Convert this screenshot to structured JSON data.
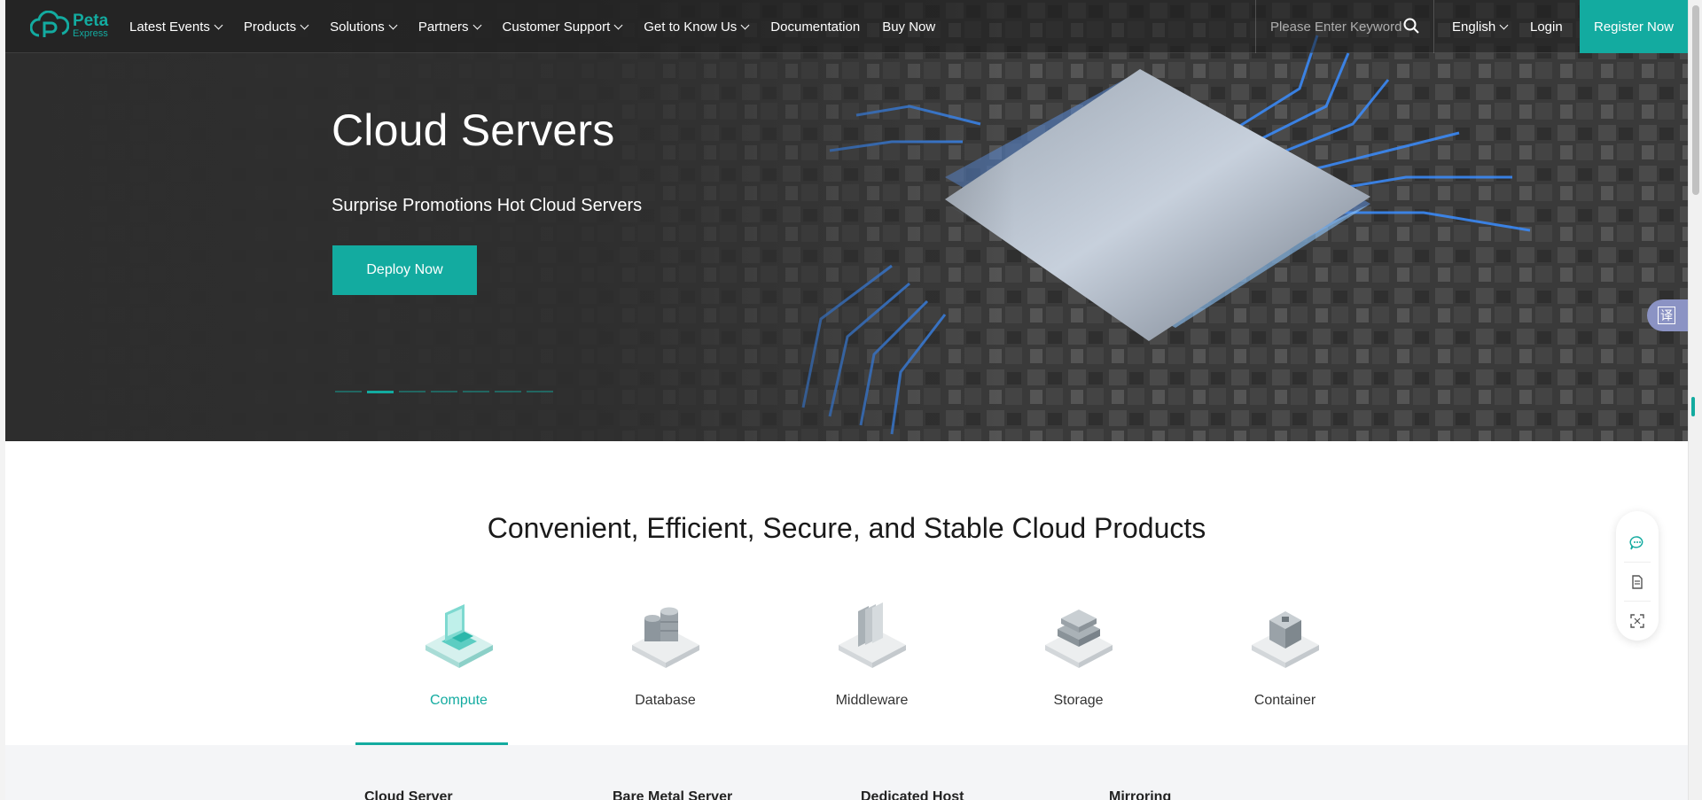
{
  "header": {
    "logo": {
      "name": "Peta",
      "sub": "Express"
    },
    "nav": [
      {
        "label": "Latest Events",
        "dropdown": true
      },
      {
        "label": "Products",
        "dropdown": true
      },
      {
        "label": "Solutions",
        "dropdown": true
      },
      {
        "label": "Partners",
        "dropdown": true
      },
      {
        "label": "Customer Support",
        "dropdown": true
      },
      {
        "label": "Get to Know Us",
        "dropdown": true
      },
      {
        "label": "Documentation",
        "dropdown": false
      },
      {
        "label": "Buy Now",
        "dropdown": false
      }
    ],
    "search": {
      "placeholder": "Please Enter Keyword",
      "icon": "search-icon"
    },
    "language": "English",
    "login": "Login",
    "register": "Register Now"
  },
  "hero": {
    "title": "Cloud Servers",
    "subtitle": "Surprise Promotions Hot Cloud Servers",
    "cta": "Deploy Now",
    "slide_count": 7,
    "active_slide": 2
  },
  "products": {
    "title": "Convenient, Efficient, Secure, and Stable Cloud Products",
    "categories": [
      {
        "label": "Compute",
        "icon": "compute-icon",
        "active": true
      },
      {
        "label": "Database",
        "icon": "database-icon",
        "active": false
      },
      {
        "label": "Middleware",
        "icon": "middleware-icon",
        "active": false
      },
      {
        "label": "Storage",
        "icon": "storage-icon",
        "active": false
      },
      {
        "label": "Container",
        "icon": "container-icon",
        "active": false
      }
    ],
    "compute_items": [
      "Cloud Server",
      "Bare Metal Server",
      "Dedicated Host",
      "Mirroring"
    ]
  },
  "floaters": {
    "translate_glyph": "译",
    "side_icons": [
      "chat-icon",
      "document-icon",
      "scan-icon"
    ]
  },
  "colors": {
    "accent": "#13aba0",
    "dark": "#2d2d2d",
    "text": "#1a1a1a"
  }
}
